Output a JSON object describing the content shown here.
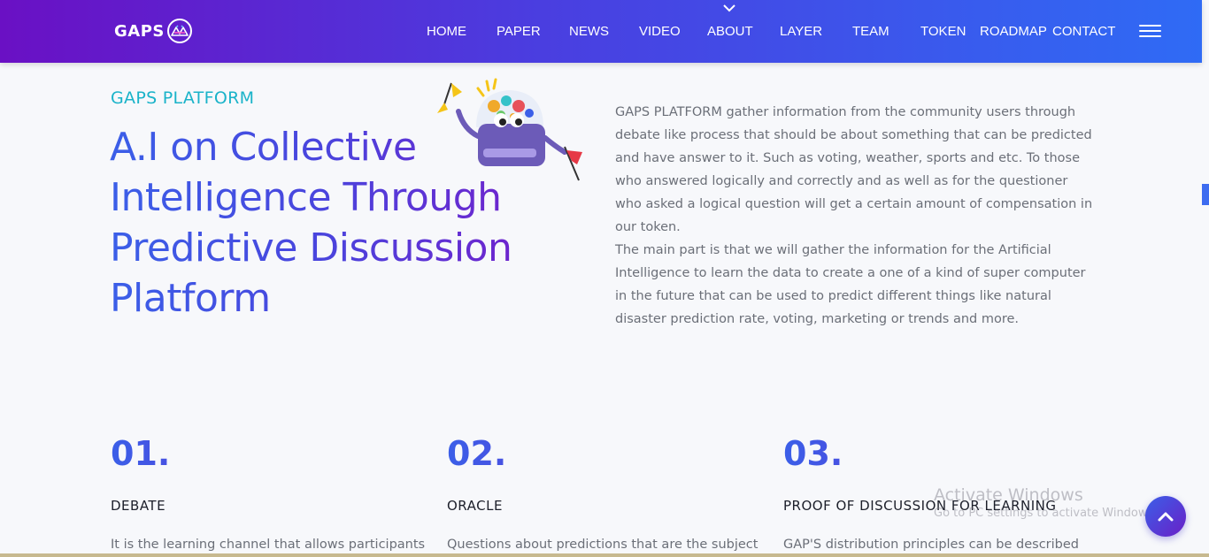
{
  "brand": {
    "logo_text": "GAPS"
  },
  "nav": {
    "items": [
      "HOME",
      "PAPER",
      "NEWS",
      "VIDEO",
      "ABOUT",
      "LAYER",
      "TEAM",
      "TOKEN",
      "ROADMAP",
      "CONTACT"
    ]
  },
  "hero": {
    "eyebrow": "GAPS PLATFORM",
    "headline": "A.I on Collective Intelligence Through Predictive Discussion Platform"
  },
  "description": {
    "p1": "GAPS PLATFORM gather information from the community users through debate like process that should be about something that can be predicted and have answer to it. Such as voting, weather, sports and etc. To those who answered logically and correctly and as well as for the questioner who asked a logical question will get a certain amount of compensation in our token.",
    "p2": "The main part is that we will gather the information for the Artificial Intelligence to learn the data to create a one of a kind of super computer in the future that can be used to predict different things like natural disaster prediction rate, voting, marketing or trends and more."
  },
  "features": [
    {
      "num": "01.",
      "title": "DEBATE",
      "text": "It is the learning channel that allows participants"
    },
    {
      "num": "02.",
      "title": "ORACLE",
      "text": "Questions about predictions that are the subject"
    },
    {
      "num": "03.",
      "title": "PROOF OF DISCUSSION FOR LEARNING",
      "text": "GAP'S distribution principles can be described"
    }
  ],
  "watermark": {
    "line1": "Activate Windows",
    "line2": "Go to PC settings to activate Windows."
  },
  "colors": {
    "nav_start": "#6a10c4",
    "nav_end": "#2f6bf5",
    "accent_teal": "#1ab3c9",
    "headline_blue": "#3b5fe8",
    "headline_purple": "#7b18c8"
  },
  "icons": {
    "nav_chevron": "chevron-down-icon",
    "menu": "hamburger-icon",
    "back_to_top": "chevron-up-icon"
  }
}
